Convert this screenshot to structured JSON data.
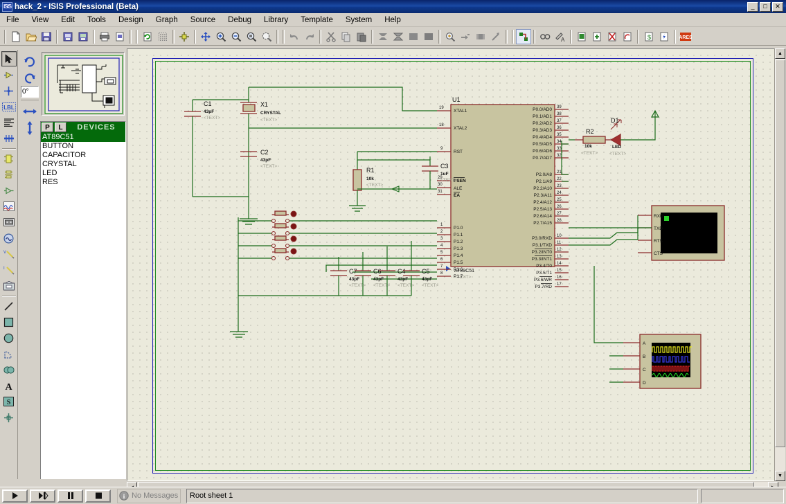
{
  "window": {
    "title": "hack_2 - ISIS Professional (Beta)",
    "app_icon": "isis-icon",
    "minimize": "_",
    "maximize": "□",
    "close": "✕"
  },
  "menubar": {
    "items": [
      {
        "label": "File"
      },
      {
        "label": "View"
      },
      {
        "label": "Edit"
      },
      {
        "label": "Tools"
      },
      {
        "label": "Design"
      },
      {
        "label": "Graph"
      },
      {
        "label": "Source"
      },
      {
        "label": "Debug"
      },
      {
        "label": "Library"
      },
      {
        "label": "Template"
      },
      {
        "label": "System"
      },
      {
        "label": "Help"
      }
    ]
  },
  "toolbar": {
    "groups": [
      [
        "new-file-icon",
        "open-folder-icon",
        "save-icon"
      ],
      [
        "import-section-icon",
        "export-section-icon"
      ],
      [
        "print-icon",
        "print-area-icon"
      ],
      [
        "refresh-icon",
        "toggle-grid-icon"
      ],
      [
        "origin-icon"
      ],
      [
        "pan-icon",
        "zoom-in-icon",
        "zoom-out-icon",
        "zoom-all-icon",
        "zoom-area-icon"
      ],
      [
        "undo-icon",
        "redo-icon"
      ],
      [
        "cut-icon",
        "copy-icon",
        "paste-icon"
      ],
      [
        "block-copy-icon",
        "block-move-icon",
        "block-rotate-icon",
        "block-delete-icon"
      ],
      [
        "pick-device-icon",
        "make-device-icon",
        "packaging-tool-icon",
        "decompose-icon"
      ],
      [
        "wire-autorouter-icon"
      ],
      [
        "search-tag-icon",
        "property-assignment-icon"
      ],
      [
        "design-explorer-icon",
        "new-sheet-icon",
        "remove-sheet-icon",
        "exit-sheet-icon"
      ],
      [
        "bill-of-materials-icon",
        "electrical-rule-check-icon"
      ],
      [
        "ares-icon"
      ]
    ],
    "ares_label": "ARES"
  },
  "left_tools": {
    "items": [
      {
        "name": "selection-mode-icon",
        "selected": true
      },
      {
        "name": "component-mode-icon",
        "selected": false
      },
      {
        "name": "junction-dot-mode-icon",
        "selected": false
      },
      {
        "name": "wire-label-mode-icon",
        "selected": false,
        "label": "LBL"
      },
      {
        "name": "text-script-mode-icon",
        "selected": false
      },
      {
        "name": "buses-mode-icon",
        "selected": false
      },
      {
        "name": "subcircuit-mode-icon",
        "selected": false
      },
      {
        "name": "terminals-mode-icon",
        "selected": false
      },
      {
        "name": "device-pin-mode-icon",
        "selected": false
      },
      {
        "name": "graph-mode-icon",
        "selected": false
      },
      {
        "name": "tape-recorder-mode-icon",
        "selected": false
      },
      {
        "name": "generator-mode-icon",
        "selected": false
      },
      {
        "name": "voltage-probe-mode-icon",
        "selected": false
      },
      {
        "name": "current-probe-mode-icon",
        "selected": false
      },
      {
        "name": "virtual-instrument-mode-icon",
        "selected": false
      },
      {
        "name": "line-tool-icon",
        "selected": false
      },
      {
        "name": "box-tool-icon",
        "selected": false
      },
      {
        "name": "circle-tool-icon",
        "selected": false
      },
      {
        "name": "arc-tool-icon",
        "selected": false
      },
      {
        "name": "path-tool-icon",
        "selected": false
      },
      {
        "name": "text-tool-icon",
        "selected": false
      },
      {
        "name": "symbol-tool-icon",
        "selected": false
      },
      {
        "name": "marker-tool-icon",
        "selected": false
      }
    ]
  },
  "orientation": {
    "rotate_ccw": "rotate-anticlockwise-icon",
    "rotate_cw": "rotate-clockwise-icon",
    "angle_value": "0°",
    "mirror_x": "mirror-horizontal-icon",
    "mirror_y": "mirror-vertical-icon"
  },
  "devices_panel": {
    "p_button": "P",
    "l_button": "L",
    "title": "DEVICES",
    "items": [
      {
        "label": "AT89C51",
        "selected": true
      },
      {
        "label": "BUTTON",
        "selected": false
      },
      {
        "label": "CAPACITOR",
        "selected": false
      },
      {
        "label": "CRYSTAL",
        "selected": false
      },
      {
        "label": "LED",
        "selected": false
      },
      {
        "label": "RES",
        "selected": false
      }
    ]
  },
  "statusbar": {
    "play": "▶",
    "step": "▶|",
    "pause": "❙❙",
    "stop": "■",
    "message_icon": "info-icon",
    "message": "No Messages",
    "sheet": "Root sheet 1",
    "coordinates": ""
  },
  "schematic": {
    "canvas_bg": "#ebeadc",
    "wire_color": "#1a6b1a",
    "body_color": "#c8c4a0",
    "outline_color": "#8b2b2b",
    "text_color": "#101010",
    "hidden_text_color": "#9a9a8c",
    "components": [
      {
        "ref": "U1",
        "value": "AT89C51",
        "type": "microcontroller",
        "left_pins": [
          {
            "num": "19",
            "label": "XTAL1"
          },
          {
            "num": "18",
            "label": "XTAL2"
          },
          {
            "num": "9",
            "label": "RST"
          },
          {
            "num": "29",
            "label": "PSEN"
          },
          {
            "num": "30",
            "label": "ALE"
          },
          {
            "num": "31",
            "label": "EA"
          },
          {
            "num": "1",
            "label": "P1.0"
          },
          {
            "num": "2",
            "label": "P1.1"
          },
          {
            "num": "3",
            "label": "P1.2"
          },
          {
            "num": "4",
            "label": "P1.3"
          },
          {
            "num": "5",
            "label": "P1.4"
          },
          {
            "num": "6",
            "label": "P1.5"
          },
          {
            "num": "7",
            "label": "P1.6"
          },
          {
            "num": "8",
            "label": "P1.7"
          }
        ],
        "right_pins": [
          {
            "num": "39",
            "label": "P0.0/AD0"
          },
          {
            "num": "38",
            "label": "P0.1/AD1"
          },
          {
            "num": "37",
            "label": "P0.2/AD2"
          },
          {
            "num": "36",
            "label": "P0.3/AD3"
          },
          {
            "num": "35",
            "label": "P0.4/AD4"
          },
          {
            "num": "34",
            "label": "P0.5/AD5"
          },
          {
            "num": "33",
            "label": "P0.6/AD6"
          },
          {
            "num": "32",
            "label": "P0.7/AD7"
          },
          {
            "num": "21",
            "label": "P2.0/A8"
          },
          {
            "num": "22",
            "label": "P2.1/A9"
          },
          {
            "num": "23",
            "label": "P2.2/A10"
          },
          {
            "num": "24",
            "label": "P2.3/A11"
          },
          {
            "num": "25",
            "label": "P2.4/A12"
          },
          {
            "num": "26",
            "label": "P2.5/A13"
          },
          {
            "num": "27",
            "label": "P2.6/A14"
          },
          {
            "num": "28",
            "label": "P2.7/A15"
          },
          {
            "num": "10",
            "label": "P3.0/RXD"
          },
          {
            "num": "11",
            "label": "P3.1/TXD"
          },
          {
            "num": "12",
            "label": "P3.2/INT0"
          },
          {
            "num": "13",
            "label": "P3.3/INT1"
          },
          {
            "num": "14",
            "label": "P3.4/T0"
          },
          {
            "num": "15",
            "label": "P3.5/T1"
          },
          {
            "num": "16",
            "label": "P3.6/WR"
          },
          {
            "num": "17",
            "label": "P3.7/RD"
          }
        ]
      },
      {
        "ref": "C1",
        "value": "43pF",
        "hidden": "<TEXT>",
        "type": "capacitor"
      },
      {
        "ref": "C2",
        "value": "43pF",
        "hidden": "<TEXT>",
        "type": "capacitor"
      },
      {
        "ref": "C3",
        "value": "1uF",
        "hidden": "<TEXT>",
        "type": "capacitor"
      },
      {
        "ref": "C4",
        "value": "43pF",
        "hidden": "<TEXT>",
        "type": "capacitor"
      },
      {
        "ref": "C5",
        "value": "43pF",
        "hidden": "<TEXT>",
        "type": "capacitor"
      },
      {
        "ref": "C6",
        "value": "43pF",
        "hidden": "<TEXT>",
        "type": "capacitor"
      },
      {
        "ref": "C7",
        "value": "43pF",
        "hidden": "<TEXT>",
        "type": "capacitor"
      },
      {
        "ref": "X1",
        "value": "CRYSTAL",
        "hidden": "<TEXT>",
        "type": "crystal"
      },
      {
        "ref": "R1",
        "value": "10k",
        "hidden": "<TEXT>",
        "type": "resistor"
      },
      {
        "ref": "R2",
        "value": "10k",
        "hidden": "<TEXT>",
        "type": "resistor"
      },
      {
        "ref": "D1",
        "value": "LED",
        "hidden": "<TEXT>",
        "type": "led"
      }
    ],
    "virtual_terminal": {
      "pins": [
        "RXD",
        "TXD",
        "RTS",
        "CTS"
      ],
      "screen_bg": "#000000",
      "cursor_color": "#2ad02a"
    },
    "oscilloscope": {
      "pins": [
        "A",
        "B",
        "C",
        "D"
      ],
      "trace_colors": [
        "#e8e820",
        "#3838e0",
        "#d02020",
        "#20c020"
      ],
      "screen_bg": "#000000"
    },
    "buttons_count": 4
  }
}
